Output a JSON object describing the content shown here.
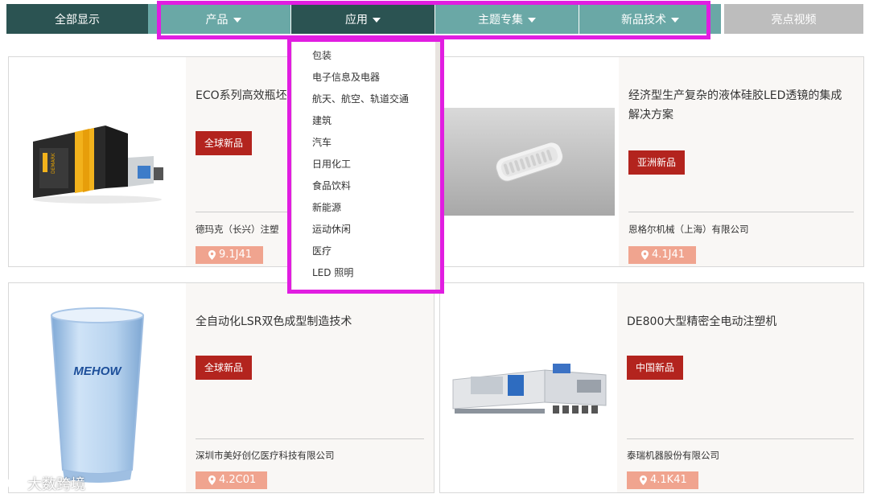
{
  "nav": {
    "all": "全部显示",
    "products": "产品",
    "applications": "应用",
    "topics": "主题专集",
    "new_tech": "新品技术",
    "videos": "亮点视频"
  },
  "dropdown": {
    "items": [
      "包装",
      "电子信息及电器",
      "航天、航空、轨道交通",
      "建筑",
      "汽车",
      "日用化工",
      "食品饮料",
      "新能源",
      "运动休闲",
      "医疗",
      "LED 照明"
    ]
  },
  "cards": [
    {
      "title": "ECO系列高效瓶坯",
      "badge": "全球新品",
      "company": "德玛克（长兴）注塑",
      "booth": "9.1J41",
      "image": "injection-machine-yellow"
    },
    {
      "title": "经济型生产复杂的液体硅胶LED透镜的集成解决方案",
      "badge": "亚洲新品",
      "company": "恩格尔机械（上海）有限公司",
      "booth": "4.1J41",
      "image": "silicone-led-lens"
    },
    {
      "title": "全自动化LSR双色成型制造技术",
      "badge": "全球新品",
      "company": "深圳市美好创亿医疗科技有限公司",
      "booth": "4.2C01",
      "image": "mehow-cup"
    },
    {
      "title": "DE800大型精密全电动注塑机",
      "badge": "中国新品",
      "company": "泰瑞机器股份有限公司",
      "booth": "4.1K41",
      "image": "electric-injection-machine"
    }
  ],
  "cup_brand": "MEHOW",
  "machine_brand": "DEMARK",
  "watermark": "大数跨境",
  "colors": {
    "nav_dark": "#2b5352",
    "nav_light": "#6aa8a6",
    "nav_video": "#bdbdbd",
    "badge_red": "#b3241e",
    "booth_salmon": "#f0a48f",
    "highlight_magenta": "#e11de1"
  }
}
